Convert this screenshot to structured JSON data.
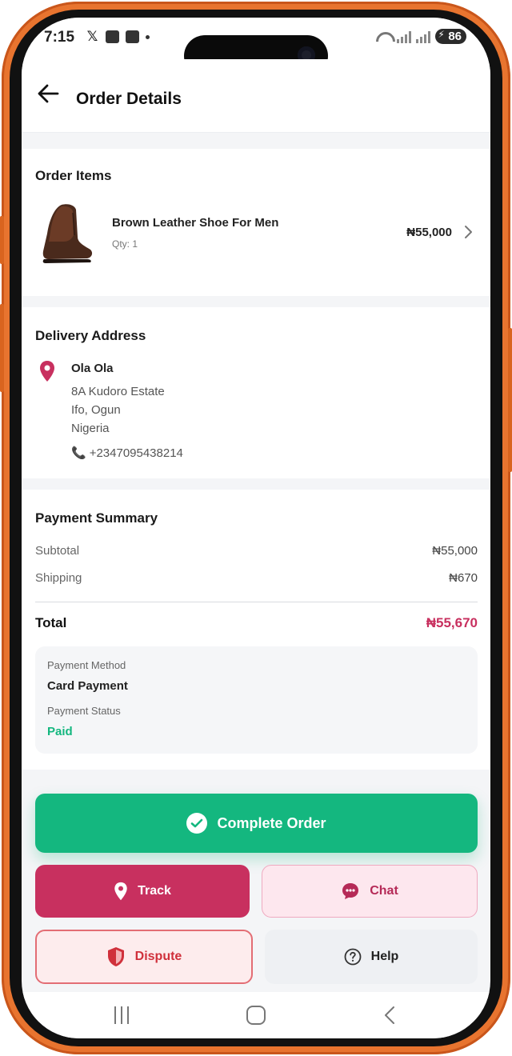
{
  "status_bar": {
    "time": "7:15",
    "battery": "86"
  },
  "header": {
    "title": "Order Details"
  },
  "order_items": {
    "title": "Order Items",
    "items": [
      {
        "name": "Brown Leather Shoe For Men",
        "qty": "Qty: 1",
        "price": "₦55,000"
      }
    ]
  },
  "delivery": {
    "title": "Delivery Address",
    "name": "Ola Ola",
    "lines": [
      "8A Kudoro Estate",
      "Ifo, Ogun",
      "Nigeria"
    ],
    "phone": "+2347095438214"
  },
  "payment_summary": {
    "title": "Payment Summary",
    "subtotal_label": "Subtotal",
    "subtotal_value": "₦55,000",
    "shipping_label": "Shipping",
    "shipping_value": "₦670",
    "total_label": "Total",
    "total_value": "₦55,670",
    "method_label": "Payment Method",
    "method_value": "Card Payment",
    "status_label": "Payment Status",
    "status_value": "Paid"
  },
  "actions": {
    "complete": "Complete Order",
    "track": "Track",
    "chat": "Chat",
    "dispute": "Dispute",
    "help": "Help"
  },
  "colors": {
    "primary_green": "#14b77f",
    "brand_pink": "#c8305f",
    "dispute_red": "#d0303b",
    "frame_orange": "#e8742f"
  }
}
